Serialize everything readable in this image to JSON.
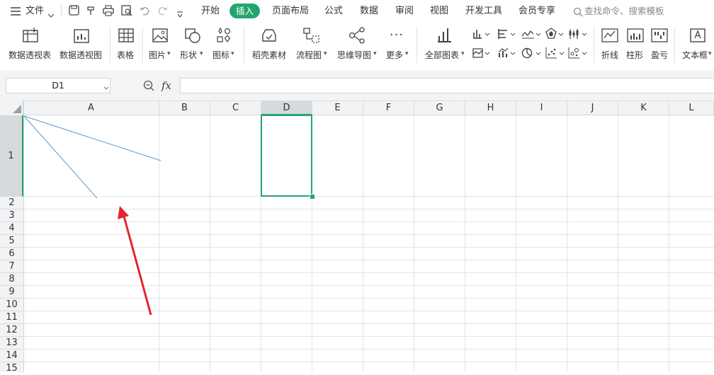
{
  "menubar": {
    "file_label": "文件",
    "tabs": [
      "开始",
      "插入",
      "页面布局",
      "公式",
      "数据",
      "审阅",
      "视图",
      "开发工具",
      "会员专享"
    ],
    "active_tab": "插入",
    "search_placeholder": "查找命令、搜索模板"
  },
  "ribbon": {
    "items": [
      "数据透视表",
      "数据透视图",
      "表格",
      "图片",
      "形状",
      "图标",
      "稻壳素材",
      "流程图",
      "思维导图",
      "更多",
      "全部图表",
      "折线",
      "柱形",
      "盈亏",
      "文本框"
    ],
    "more_glyph": "···",
    "dropdown_glyph": "▾"
  },
  "formula_bar": {
    "name_box": "D1",
    "fx_label": "fx",
    "formula_value": ""
  },
  "sheet": {
    "columns": [
      "A",
      "B",
      "C",
      "D",
      "E",
      "F",
      "G",
      "H",
      "I",
      "J",
      "K",
      "L"
    ],
    "rows": [
      "1",
      "2",
      "3",
      "4",
      "5",
      "6",
      "7",
      "8",
      "9",
      "10",
      "11",
      "12",
      "13",
      "14",
      "15"
    ],
    "active_column": "D",
    "active_row": "1",
    "active_cell": "D1"
  },
  "colors": {
    "accent": "#23a66e",
    "diagonal_line": "#5b9bd5",
    "arrow": "#e0262e",
    "header_bg": "#f2f3f5"
  }
}
